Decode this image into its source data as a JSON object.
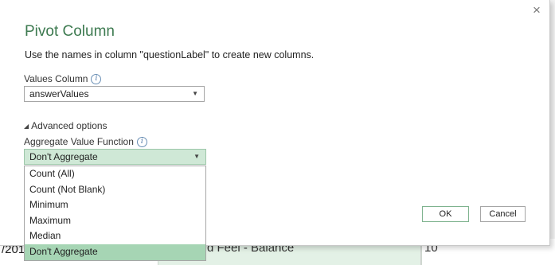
{
  "background": {
    "cell_a": "/201",
    "cell_b": "d Feel - Balance",
    "cell_c": "10"
  },
  "dialog": {
    "title": "Pivot Column",
    "description": "Use the names in column \"questionLabel\" to create new columns.",
    "close_glyph": "×",
    "values_column": {
      "label": "Values Column",
      "value": "answerValues"
    },
    "advanced_label": "Advanced options",
    "aggregate": {
      "label": "Aggregate Value Function",
      "value": "Don't Aggregate",
      "options": [
        "Count (All)",
        "Count (Not Blank)",
        "Minimum",
        "Maximum",
        "Median",
        "Don't Aggregate"
      ],
      "selected_index": 5
    },
    "ok_label": "OK",
    "cancel_label": "Cancel"
  },
  "colors": {
    "title": "#3d7a50",
    "selected_option": "#a6d5b4",
    "active_select": "#cfe8d6"
  }
}
